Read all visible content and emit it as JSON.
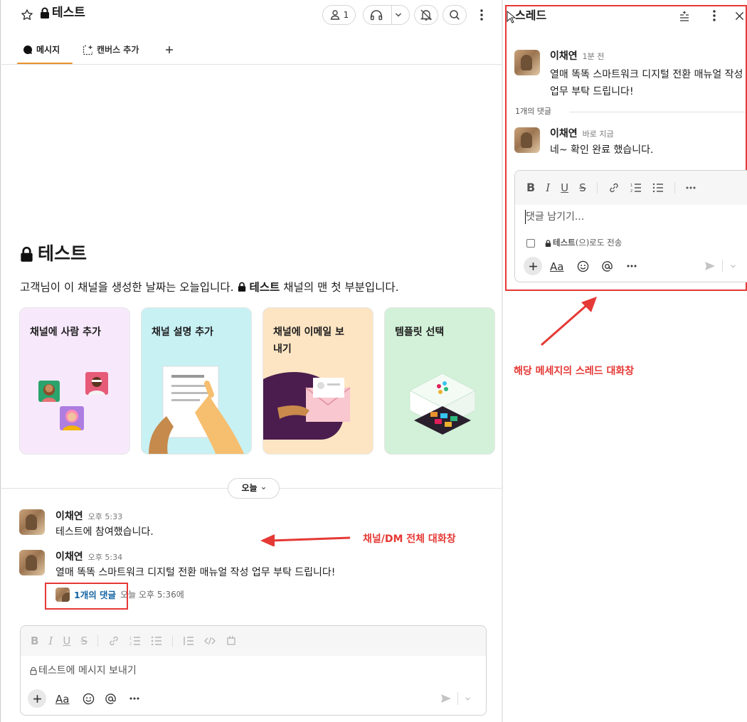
{
  "channel": {
    "name": "테스트",
    "member_count": "1",
    "tabs": [
      {
        "label": "메시지"
      },
      {
        "label": "캔버스 추가"
      }
    ],
    "intro_title": "테스트",
    "intro_prefix": "고객님이 이 채널을 생성한 날짜는 오늘입니다.",
    "intro_channel": "테스트",
    "intro_suffix": "채널의 맨 첫 부분입니다.",
    "cards": [
      {
        "title": "채널에 사람 추가"
      },
      {
        "title": "채널 설명 추가"
      },
      {
        "title": "채널에 이메일 보내기"
      },
      {
        "title": "템플릿 선택"
      }
    ],
    "date_divider": "오늘",
    "messages": [
      {
        "user": "이채연",
        "time": "오후 5:33",
        "text": "테스트에 참여했습니다."
      },
      {
        "user": "이채연",
        "time": "오후 5:34",
        "text": "열매 똑똑 스마트워크 디지털 전환 매뉴얼 작성 업무 부탁 드립니다!",
        "reply_count": "1개의 댓글",
        "reply_time": "오늘 오후 5:36에"
      }
    ],
    "composer_placeholder": "테스트에 메시지 보내기",
    "composer_aa": "Aa"
  },
  "thread": {
    "title": "스레드",
    "parent": {
      "user": "이채연",
      "time": "1분 전",
      "text": "열매 똑똑 스마트워크 디지털 전환 매뉴얼 작성 업무 부탁 드립니다!"
    },
    "reply_divider": "1개의 댓글",
    "reply": {
      "user": "이채연",
      "time": "바로 지금",
      "text": "네~ 확인 완료 했습니다."
    },
    "composer_placeholder": "댓글 남기기...",
    "also_send_channel": "테스트",
    "also_send_suffix": "(으)로도 전송",
    "composer_aa": "Aa"
  },
  "annotations": {
    "thread_label": "해당 메세지의 스레드 대화창",
    "channel_label": "채널/DM 전체 대화창"
  },
  "colors": {
    "accent": "#1264a3",
    "tab_underline": "#e8912d",
    "annotation": "#e53935"
  }
}
